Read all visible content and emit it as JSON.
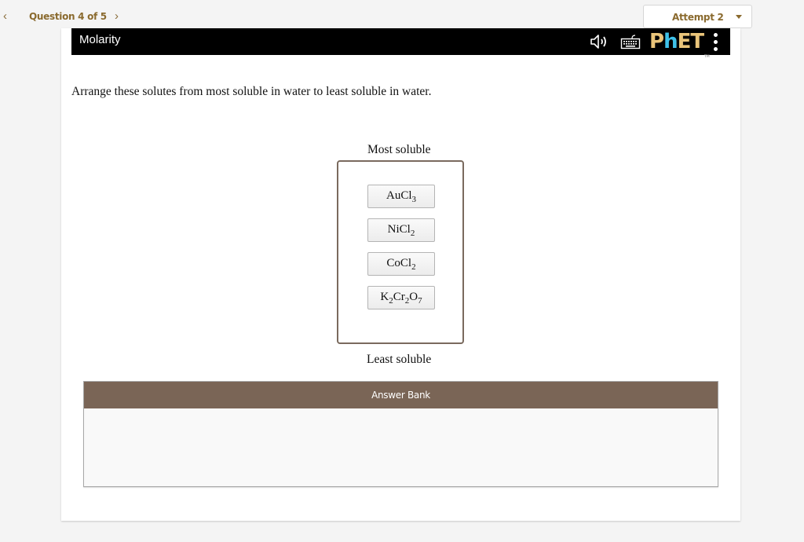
{
  "nav": {
    "prev_icon": "chevron-left-icon",
    "title": "Question 4 of 5",
    "next_icon": "chevron-right-icon",
    "attempt_label": "Attempt 2"
  },
  "sim": {
    "title": "Molarity",
    "icons": [
      "sound-icon",
      "keyboard-icon",
      "phet-logo",
      "menu-dots-icon"
    ],
    "logo": {
      "part1": "P",
      "part2": "h",
      "part3": "ET",
      "tm": "TM"
    }
  },
  "question": {
    "prompt": "Arrange these solutes from most soluble in water to least soluble in water.",
    "top_label": "Most soluble",
    "bottom_label": "Least soluble",
    "items": [
      {
        "parts": [
          [
            "Au",
            ""
          ],
          [
            "Cl",
            "3"
          ]
        ]
      },
      {
        "parts": [
          [
            "Ni",
            ""
          ],
          [
            "Cl",
            "2"
          ]
        ]
      },
      {
        "parts": [
          [
            "Co",
            ""
          ],
          [
            "Cl",
            "2"
          ]
        ]
      },
      {
        "parts": [
          [
            "K",
            "2"
          ],
          [
            "Cr",
            "2"
          ],
          [
            "O",
            "7"
          ]
        ]
      }
    ],
    "items_text": [
      "AuCl3",
      "NiCl2",
      "CoCl2",
      "K2Cr2O7"
    ]
  },
  "answer_bank": {
    "title": "Answer Bank",
    "items": []
  },
  "colors": {
    "accent_gold": "#8a6a2e",
    "bank_header": "#7a6556",
    "dropzone_border": "#7a6a5e",
    "phet_gold": "#e9c47a",
    "phet_blue": "#3fc1e8"
  }
}
